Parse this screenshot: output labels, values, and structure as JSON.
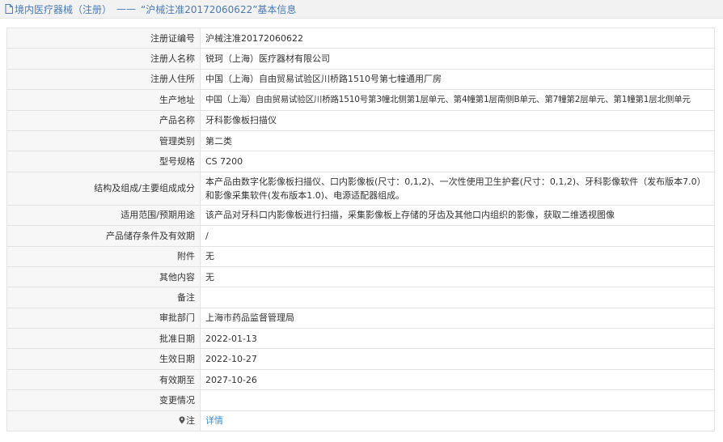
{
  "header": {
    "category": "境内医疗器械（注册）",
    "separator": "——",
    "record_title": "“沪械注准20172060622”基本信息",
    "icon": "document-icon"
  },
  "rows": [
    {
      "key": "注册证编号",
      "value": "沪械注准20172060622"
    },
    {
      "key": "注册人名称",
      "value": "锐珂（上海）医疗器材有限公司"
    },
    {
      "key": "注册人住所",
      "value": "中国（上海）自由贸易试验区川桥路1510号第七幢通用厂房"
    },
    {
      "key": "生产地址",
      "value": "中国（上海）自由贸易试验区川桥路1510号第3幢北侧第1层单元、第4幢第1层南侧B单元、第7幢第2层单元、第1幢第1层北侧单元"
    },
    {
      "key": "产品名称",
      "value": "牙科影像板扫描仪"
    },
    {
      "key": "管理类别",
      "value": "第二类"
    },
    {
      "key": "型号规格",
      "value": "CS 7200"
    },
    {
      "key": "结构及组成/主要组成成分",
      "value": "本产品由数字化影像板扫描仪、口内影像板(尺寸：0,1,2)、一次性使用卫生护套(尺寸：0,1,2)、牙科影像软件（发布版本7.0）和影像采集软件(发布版本1.0)、电源适配器组成。"
    },
    {
      "key": "适用范围/预期用途",
      "value": "该产品对牙科口内影像板进行扫描，采集影像板上存储的牙齿及其他口内组织的影像，获取二维透视图像"
    },
    {
      "key": "产品储存条件及有效期",
      "value": "/"
    },
    {
      "key": "附件",
      "value": "无"
    },
    {
      "key": "其他内容",
      "value": "无"
    },
    {
      "key": "备注",
      "value": ""
    },
    {
      "key": "审批部门",
      "value": "上海市药品监督管理局"
    },
    {
      "key": "批准日期",
      "value": "2022-01-13"
    },
    {
      "key": "生效日期",
      "value": "2022-10-27"
    },
    {
      "key": "有效期至",
      "value": "2027-10-26"
    },
    {
      "key": "变更情况",
      "value": ""
    },
    {
      "key": "注",
      "value": "详情",
      "key_icon": "pin-icon",
      "value_is_link": true
    }
  ],
  "colors": {
    "link": "#3a8bd6",
    "header_text": "#4a7ab5",
    "border": "#e3e3e3"
  }
}
